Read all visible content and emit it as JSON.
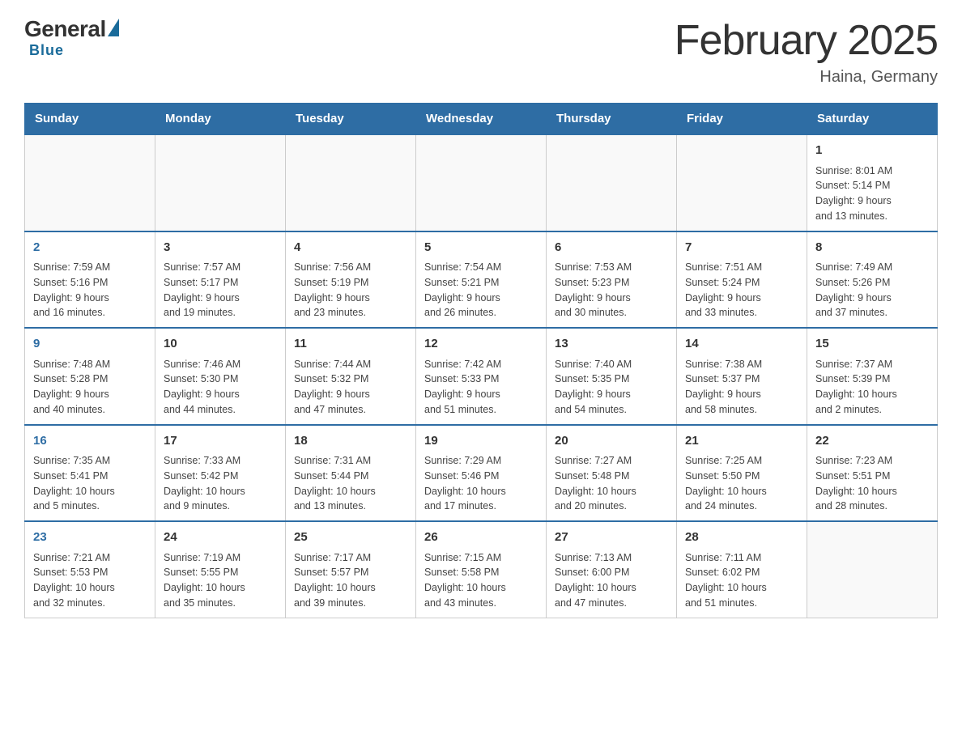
{
  "header": {
    "logo": {
      "general": "General",
      "triangle": "",
      "blue": "Blue"
    },
    "title": "February 2025",
    "location": "Haina, Germany"
  },
  "weekdays": [
    "Sunday",
    "Monday",
    "Tuesday",
    "Wednesday",
    "Thursday",
    "Friday",
    "Saturday"
  ],
  "weeks": [
    [
      {
        "day": "",
        "info": ""
      },
      {
        "day": "",
        "info": ""
      },
      {
        "day": "",
        "info": ""
      },
      {
        "day": "",
        "info": ""
      },
      {
        "day": "",
        "info": ""
      },
      {
        "day": "",
        "info": ""
      },
      {
        "day": "1",
        "info": "Sunrise: 8:01 AM\nSunset: 5:14 PM\nDaylight: 9 hours\nand 13 minutes."
      }
    ],
    [
      {
        "day": "2",
        "info": "Sunrise: 7:59 AM\nSunset: 5:16 PM\nDaylight: 9 hours\nand 16 minutes."
      },
      {
        "day": "3",
        "info": "Sunrise: 7:57 AM\nSunset: 5:17 PM\nDaylight: 9 hours\nand 19 minutes."
      },
      {
        "day": "4",
        "info": "Sunrise: 7:56 AM\nSunset: 5:19 PM\nDaylight: 9 hours\nand 23 minutes."
      },
      {
        "day": "5",
        "info": "Sunrise: 7:54 AM\nSunset: 5:21 PM\nDaylight: 9 hours\nand 26 minutes."
      },
      {
        "day": "6",
        "info": "Sunrise: 7:53 AM\nSunset: 5:23 PM\nDaylight: 9 hours\nand 30 minutes."
      },
      {
        "day": "7",
        "info": "Sunrise: 7:51 AM\nSunset: 5:24 PM\nDaylight: 9 hours\nand 33 minutes."
      },
      {
        "day": "8",
        "info": "Sunrise: 7:49 AM\nSunset: 5:26 PM\nDaylight: 9 hours\nand 37 minutes."
      }
    ],
    [
      {
        "day": "9",
        "info": "Sunrise: 7:48 AM\nSunset: 5:28 PM\nDaylight: 9 hours\nand 40 minutes."
      },
      {
        "day": "10",
        "info": "Sunrise: 7:46 AM\nSunset: 5:30 PM\nDaylight: 9 hours\nand 44 minutes."
      },
      {
        "day": "11",
        "info": "Sunrise: 7:44 AM\nSunset: 5:32 PM\nDaylight: 9 hours\nand 47 minutes."
      },
      {
        "day": "12",
        "info": "Sunrise: 7:42 AM\nSunset: 5:33 PM\nDaylight: 9 hours\nand 51 minutes."
      },
      {
        "day": "13",
        "info": "Sunrise: 7:40 AM\nSunset: 5:35 PM\nDaylight: 9 hours\nand 54 minutes."
      },
      {
        "day": "14",
        "info": "Sunrise: 7:38 AM\nSunset: 5:37 PM\nDaylight: 9 hours\nand 58 minutes."
      },
      {
        "day": "15",
        "info": "Sunrise: 7:37 AM\nSunset: 5:39 PM\nDaylight: 10 hours\nand 2 minutes."
      }
    ],
    [
      {
        "day": "16",
        "info": "Sunrise: 7:35 AM\nSunset: 5:41 PM\nDaylight: 10 hours\nand 5 minutes."
      },
      {
        "day": "17",
        "info": "Sunrise: 7:33 AM\nSunset: 5:42 PM\nDaylight: 10 hours\nand 9 minutes."
      },
      {
        "day": "18",
        "info": "Sunrise: 7:31 AM\nSunset: 5:44 PM\nDaylight: 10 hours\nand 13 minutes."
      },
      {
        "day": "19",
        "info": "Sunrise: 7:29 AM\nSunset: 5:46 PM\nDaylight: 10 hours\nand 17 minutes."
      },
      {
        "day": "20",
        "info": "Sunrise: 7:27 AM\nSunset: 5:48 PM\nDaylight: 10 hours\nand 20 minutes."
      },
      {
        "day": "21",
        "info": "Sunrise: 7:25 AM\nSunset: 5:50 PM\nDaylight: 10 hours\nand 24 minutes."
      },
      {
        "day": "22",
        "info": "Sunrise: 7:23 AM\nSunset: 5:51 PM\nDaylight: 10 hours\nand 28 minutes."
      }
    ],
    [
      {
        "day": "23",
        "info": "Sunrise: 7:21 AM\nSunset: 5:53 PM\nDaylight: 10 hours\nand 32 minutes."
      },
      {
        "day": "24",
        "info": "Sunrise: 7:19 AM\nSunset: 5:55 PM\nDaylight: 10 hours\nand 35 minutes."
      },
      {
        "day": "25",
        "info": "Sunrise: 7:17 AM\nSunset: 5:57 PM\nDaylight: 10 hours\nand 39 minutes."
      },
      {
        "day": "26",
        "info": "Sunrise: 7:15 AM\nSunset: 5:58 PM\nDaylight: 10 hours\nand 43 minutes."
      },
      {
        "day": "27",
        "info": "Sunrise: 7:13 AM\nSunset: 6:00 PM\nDaylight: 10 hours\nand 47 minutes."
      },
      {
        "day": "28",
        "info": "Sunrise: 7:11 AM\nSunset: 6:02 PM\nDaylight: 10 hours\nand 51 minutes."
      },
      {
        "day": "",
        "info": ""
      }
    ]
  ]
}
